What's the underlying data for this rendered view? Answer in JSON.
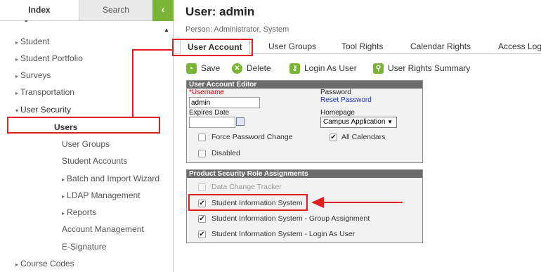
{
  "sidebar": {
    "tabs": {
      "index": "Index",
      "search": "Search",
      "collapse": "‹"
    },
    "items": [
      {
        "label": "Student",
        "arrow": "▸"
      },
      {
        "label": "Student Portfolio",
        "arrow": "▸"
      },
      {
        "label": "Surveys",
        "arrow": "▸"
      },
      {
        "label": "Transportation",
        "arrow": "▸"
      },
      {
        "label": "User Security",
        "arrow": "▾"
      },
      {
        "label": "Users",
        "arrow": ""
      },
      {
        "label": "User Groups",
        "arrow": ""
      },
      {
        "label": "Student Accounts",
        "arrow": ""
      },
      {
        "label": "Batch and Import Wizard",
        "arrow": "▸"
      },
      {
        "label": "LDAP Management",
        "arrow": "▸"
      },
      {
        "label": "Reports",
        "arrow": "▸"
      },
      {
        "label": "Account Management",
        "arrow": ""
      },
      {
        "label": "E-Signature",
        "arrow": ""
      },
      {
        "label": "Course Codes",
        "arrow": "▸"
      }
    ]
  },
  "header": {
    "title": "User: admin",
    "subtitle": "Person: Administrator, System"
  },
  "tabs": [
    "User Account",
    "User Groups",
    "Tool Rights",
    "Calendar Rights",
    "Access Log"
  ],
  "toolbar": {
    "save": "Save",
    "delete": "Delete",
    "login_as_user": "Login As User",
    "user_rights_summary": "User Rights Summary"
  },
  "editor": {
    "header": "User Account Editor",
    "username_required_mark": "*",
    "username_label": "Username",
    "username_value": "admin",
    "password_label": "Password",
    "reset_password": "Reset Password",
    "expires_label": "Expires Date",
    "expires_value": "",
    "homepage_label": "Homepage",
    "homepage_value": "Campus Application",
    "homepage_caret": "▼",
    "force_password_change": "Force Password Change",
    "all_calendars": "All Calendars",
    "disabled": "Disabled"
  },
  "roles": {
    "header": "Product Security Role Assignments",
    "items": [
      {
        "label": "Data Change Tracker",
        "checked": false,
        "disabled": true
      },
      {
        "label": "Student Information System",
        "checked": true,
        "disabled": false
      },
      {
        "label": "Student Information System - Group Assignment",
        "checked": true,
        "disabled": false
      },
      {
        "label": "Student Information System - Login As User",
        "checked": true,
        "disabled": false
      }
    ]
  },
  "checkmark": "✔",
  "colors": {
    "accent": "#7ab435",
    "annotation": "#e02020",
    "panel_header": "#6b6b6b",
    "link": "#1a32c8"
  }
}
